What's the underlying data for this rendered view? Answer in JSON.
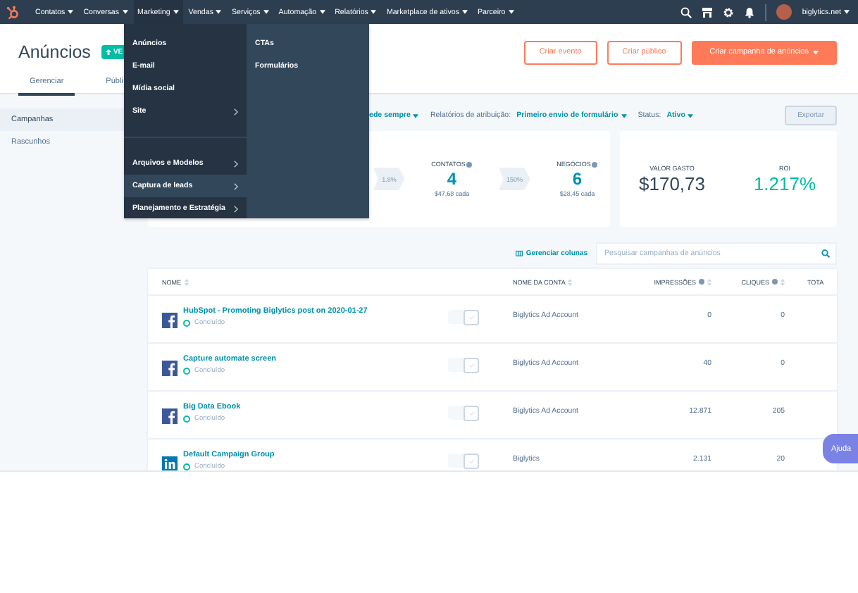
{
  "nav": {
    "items": [
      {
        "label": "Contatos",
        "selected": false
      },
      {
        "label": "Conversas",
        "selected": false
      },
      {
        "label": "Marketing",
        "selected": true
      },
      {
        "label": "Vendas",
        "selected": false
      },
      {
        "label": "Serviços",
        "selected": false
      },
      {
        "label": "Automação",
        "selected": false
      },
      {
        "label": "Relatórios",
        "selected": false
      },
      {
        "label": "Marketplace de ativos",
        "selected": false
      },
      {
        "label": "Parceiro",
        "selected": false
      }
    ],
    "account": "biglytics.net"
  },
  "menu": {
    "groups": [
      [
        {
          "label": "Anúncios",
          "submenu": false,
          "selected": false
        },
        {
          "label": "E-mail",
          "submenu": false,
          "selected": false
        },
        {
          "label": "Mídia social",
          "submenu": false,
          "selected": false
        },
        {
          "label": "Site",
          "submenu": true,
          "selected": false
        }
      ],
      [
        {
          "label": "Arquivos e Modelos",
          "submenu": true,
          "selected": false
        },
        {
          "label": "Captura de leads",
          "submenu": true,
          "selected": true
        },
        {
          "label": "Planejamento e Estratégia",
          "submenu": true,
          "selected": false
        }
      ]
    ],
    "submenu": [
      {
        "label": "CTAs"
      },
      {
        "label": "Formulários"
      }
    ]
  },
  "header": {
    "title": "Anúncios",
    "badge": "VE",
    "buttons": [
      {
        "label": "Criar evento",
        "kind": "outline"
      },
      {
        "label": "Criar público",
        "kind": "outline"
      },
      {
        "label": "Criar campanha de anúncios",
        "kind": "primary"
      }
    ]
  },
  "tabs": [
    {
      "label": "Gerenciar",
      "selected": true
    },
    {
      "label": "Públi",
      "selected": false
    }
  ],
  "sidebar": {
    "items": [
      {
        "label": "Campanhas",
        "selected": true
      },
      {
        "label": "Rascunhos",
        "selected": false
      }
    ]
  },
  "filters": [
    {
      "value": "ede sempre"
    },
    {
      "label": "Relatórios de atribuição:",
      "value": "Primeiro envio de formulário"
    },
    {
      "label": "Status:",
      "value": "Ativo"
    }
  ],
  "export_button": "Exportar",
  "funnel": [
    {
      "kind": "rate",
      "text": "1.8%"
    },
    {
      "kind": "metric",
      "label": "CONTATOS",
      "value": "4",
      "sub": "$47,68 cada"
    },
    {
      "kind": "rate",
      "text": "150%"
    },
    {
      "kind": "metric",
      "label": "NEGÓCIOS",
      "value": "6",
      "sub": "$28,45 cada"
    }
  ],
  "summary": [
    {
      "label": "VALOR GASTO",
      "value": "$170,73",
      "kind": "neutral"
    },
    {
      "label": "ROI",
      "value": "1.217%",
      "kind": "positive"
    }
  ],
  "table": {
    "manage_columns": "Gerenciar colunas",
    "search": {
      "placeholder": "Pesquisar campanhas de anúncios"
    },
    "columns": [
      {
        "label": "NOME",
        "info": false
      },
      {
        "label": "NOME DA CONTA",
        "info": false
      },
      {
        "label": "IMPRESSÕES",
        "info": true
      },
      {
        "label": "CLIQUES",
        "info": true
      },
      {
        "label": "TOTA",
        "info": false
      }
    ],
    "rows": [
      {
        "kind": "facebook",
        "name": "HubSpot - Promoting Biglytics post on 2020-01-27",
        "status": "Concluído",
        "on": true,
        "account": "Biglytics Ad Account",
        "impressions": "0",
        "clicks": "0"
      },
      {
        "kind": "facebook",
        "name": "Capture automate screen",
        "status": "Concluído",
        "on": true,
        "account": "Biglytics Ad Account",
        "impressions": "40",
        "clicks": "0"
      },
      {
        "kind": "facebook",
        "name": "Big Data Ebook",
        "status": "Concluído",
        "on": true,
        "account": "Biglytics Ad Account",
        "impressions": "12.871",
        "clicks": "205"
      },
      {
        "kind": "linkedin",
        "name": "Default Campaign Group",
        "status": "Concluído",
        "on": true,
        "account": "Biglytics",
        "impressions": "2.131",
        "clicks": "20"
      }
    ]
  },
  "help_button": "Ajuda"
}
